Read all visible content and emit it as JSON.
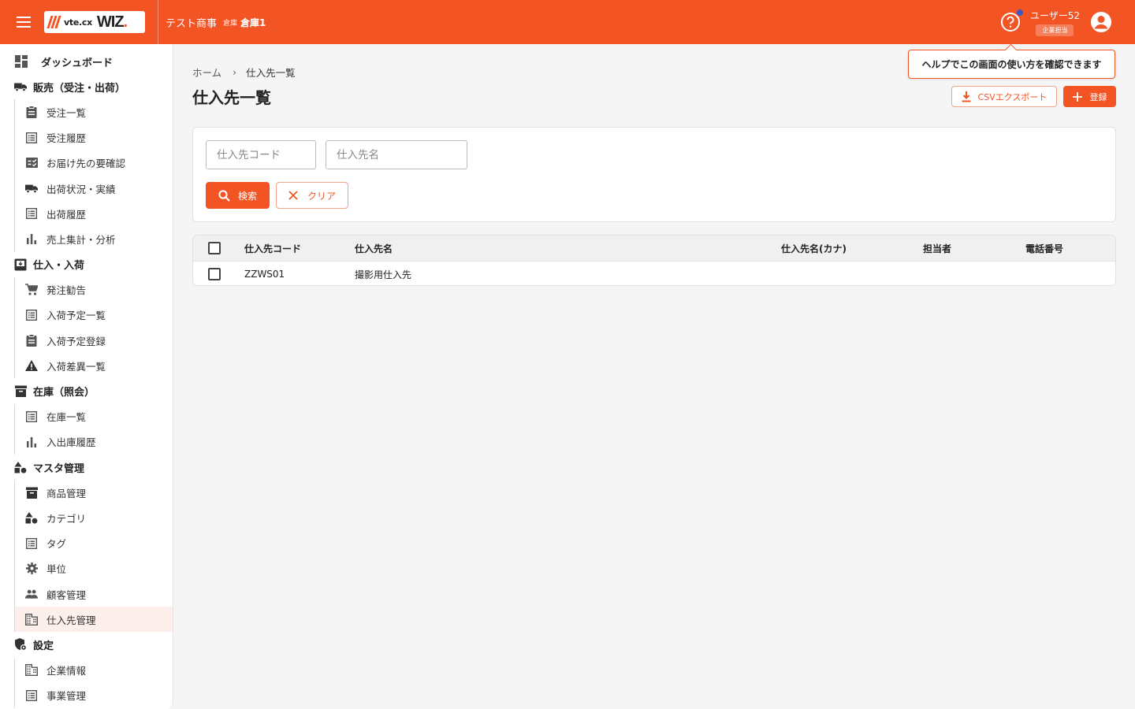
{
  "header": {
    "logo_vte": "vte.cx",
    "logo_wiz": "WIZ",
    "logo_dot": ".",
    "company": "テスト商事",
    "warehouse_label": "倉庫",
    "warehouse_name": "倉庫1",
    "user_name": "ユーザー52",
    "user_role": "企業担当",
    "accent": "#f35424"
  },
  "sidebar": {
    "items": [
      {
        "label": "ダッシュボード",
        "type": "top",
        "icon": "dashboard-icon"
      },
      {
        "label": "販売（受注・出荷）",
        "type": "group",
        "icon": "truck-icon"
      },
      {
        "label": "受注一覧",
        "type": "sub",
        "icon": "clipboard-icon"
      },
      {
        "label": "受注履歴",
        "type": "sub",
        "icon": "list-icon"
      },
      {
        "label": "お届け先の要確認",
        "type": "sub",
        "icon": "checklist-icon"
      },
      {
        "label": "出荷状況・実績",
        "type": "sub",
        "icon": "truck-icon"
      },
      {
        "label": "出荷履歴",
        "type": "sub",
        "icon": "list-icon"
      },
      {
        "label": "売上集計・分析",
        "type": "sub",
        "icon": "bar-chart-icon"
      },
      {
        "label": "仕入・入荷",
        "type": "group",
        "icon": "inbox-icon"
      },
      {
        "label": "発注勧告",
        "type": "sub",
        "icon": "cart-icon"
      },
      {
        "label": "入荷予定一覧",
        "type": "sub",
        "icon": "list-icon"
      },
      {
        "label": "入荷予定登録",
        "type": "sub",
        "icon": "clipboard-icon"
      },
      {
        "label": "入荷差異一覧",
        "type": "sub",
        "icon": "warning-icon"
      },
      {
        "label": "在庫（照会）",
        "type": "group",
        "icon": "archive-icon"
      },
      {
        "label": "在庫一覧",
        "type": "sub",
        "icon": "list-icon"
      },
      {
        "label": "入出庫履歴",
        "type": "sub",
        "icon": "bar-chart-icon"
      },
      {
        "label": "マスタ管理",
        "type": "group",
        "icon": "shapes-icon"
      },
      {
        "label": "商品管理",
        "type": "sub",
        "icon": "archive-icon"
      },
      {
        "label": "カテゴリ",
        "type": "sub",
        "icon": "shapes-icon"
      },
      {
        "label": "タグ",
        "type": "sub",
        "icon": "list-icon"
      },
      {
        "label": "単位",
        "type": "sub",
        "icon": "gear-icon"
      },
      {
        "label": "顧客管理",
        "type": "sub",
        "icon": "people-icon"
      },
      {
        "label": "仕入先管理",
        "type": "sub",
        "icon": "building-icon",
        "active": true
      },
      {
        "label": "設定",
        "type": "group",
        "icon": "shield-gear-icon"
      },
      {
        "label": "企業情報",
        "type": "sub",
        "icon": "building-icon"
      },
      {
        "label": "事業管理",
        "type": "sub",
        "icon": "list-icon"
      }
    ]
  },
  "breadcrumb": {
    "home": "ホーム",
    "current": "仕入先一覧"
  },
  "page_title": "仕入先一覧",
  "tooltip": "ヘルプでこの画面の使い方を確認できます",
  "actions": {
    "csv_label": "CSVエクスポート",
    "register_label": "登録"
  },
  "search": {
    "code_placeholder": "仕入先コード",
    "name_placeholder": "仕入先名",
    "search_label": "検索",
    "clear_label": "クリア"
  },
  "table": {
    "headers": [
      "仕入先コード",
      "仕入先名",
      "仕入先名(カナ)",
      "担当者",
      "電話番号"
    ],
    "rows": [
      [
        "ZZWS01",
        "撮影用仕入先",
        "",
        "",
        ""
      ]
    ]
  }
}
